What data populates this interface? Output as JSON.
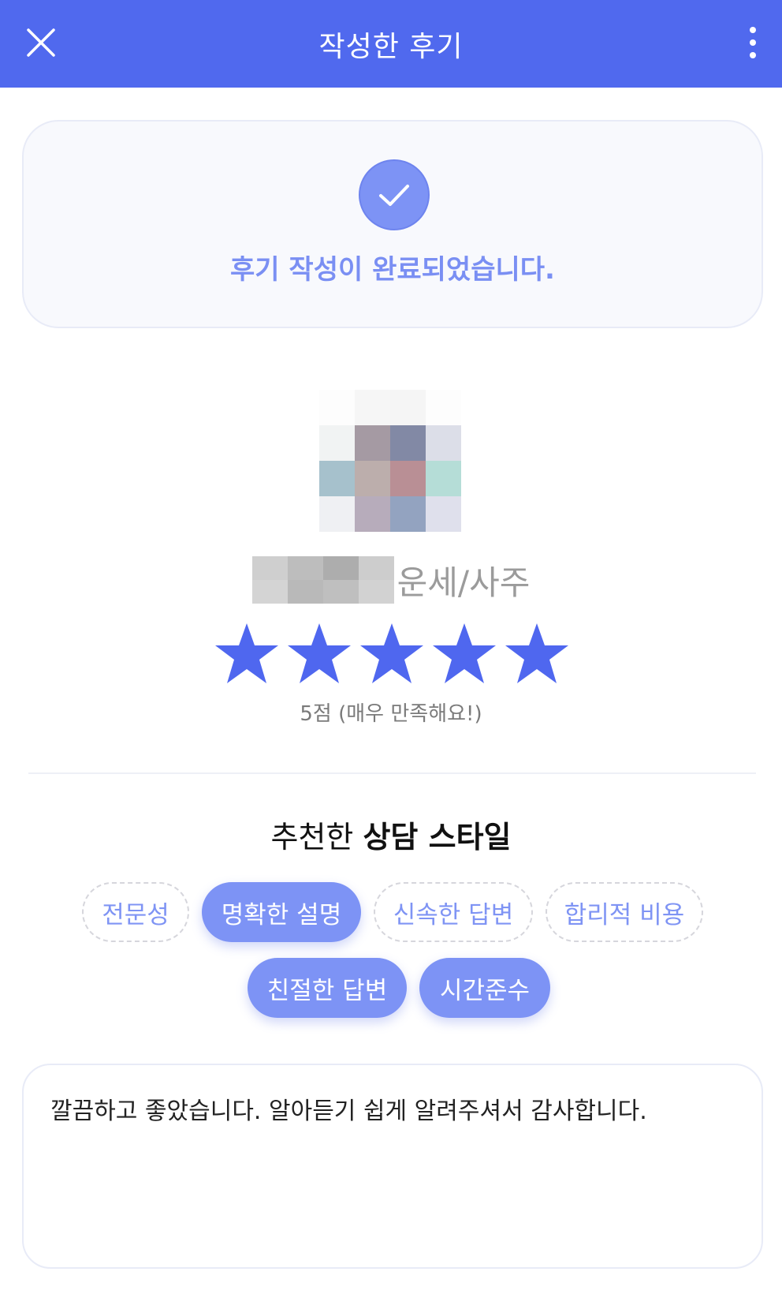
{
  "header": {
    "title": "작성한 후기",
    "close_icon": "close-icon",
    "more_icon": "more-vertical-icon",
    "background_color": "#5069ee"
  },
  "completion": {
    "icon": "check-icon",
    "message": "후기 작성이 완료되었습니다."
  },
  "counselor": {
    "category": "운세/사주"
  },
  "rating": {
    "score": 5,
    "max": 5,
    "text": "5점 (매우 만족해요!)",
    "star_color": "#4f67ef"
  },
  "style_section": {
    "title_normal": "추천한",
    "title_bold": "상담 스타일",
    "chips": [
      {
        "label": "전문성",
        "selected": false
      },
      {
        "label": "명확한 설명",
        "selected": true
      },
      {
        "label": "신속한 답변",
        "selected": false
      },
      {
        "label": "합리적 비용",
        "selected": false
      },
      {
        "label": "친절한 답변",
        "selected": true
      },
      {
        "label": "시간준수",
        "selected": true
      }
    ]
  },
  "review": {
    "text": "깔끔하고 좋았습니다. 알아듣기 쉽게 알려주셔서 감사합니다."
  }
}
